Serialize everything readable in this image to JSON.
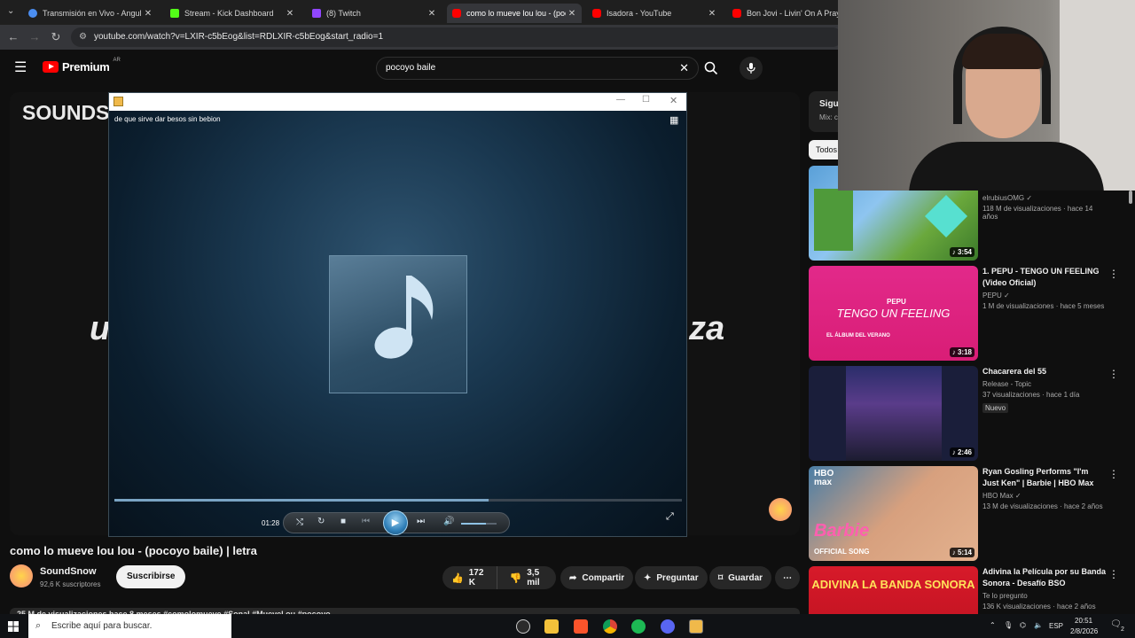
{
  "browser": {
    "tabs": [
      {
        "title": "Transmisión en Vivo - Angulism",
        "color": "#4b8ef1"
      },
      {
        "title": "Stream - Kick Dashboard",
        "color": "#53fc18"
      },
      {
        "title": "(8) Twitch",
        "color": "#9146ff"
      },
      {
        "title": "como lo mueve lou lou - (pocoy",
        "color": "#ff0000"
      },
      {
        "title": "Isadora - YouTube",
        "color": "#ff0000"
      },
      {
        "title": "Bon Jovi - Livin' On A Prayer -",
        "color": "#ff0000"
      }
    ],
    "url": "youtube.com/watch?v=LXIR-c5bEog&list=RDLXIR-c5bEog&start_radio=1"
  },
  "youtube": {
    "brand": "Premium",
    "region": "AR",
    "search_value": "pocoyo baile"
  },
  "video": {
    "bg_text_left": "SOUNDS",
    "bg_text_mid_left": "u",
    "bg_text_mid_right": "za",
    "title": "como lo mueve lou lou - (pocoyo baile) | letra",
    "channel": "SoundSnow",
    "subscribers": "92,6 K suscriptores",
    "subscribe_label": "Suscribirse",
    "likes": "172 K",
    "dislikes": "3,5 mil",
    "share_label": "Compartir",
    "ask_label": "Preguntar",
    "save_label": "Guardar",
    "desc_peek": "25 M de visualizaciones  hace 8 meses  #comolomueve #Sonal #Muevel ou #pocoyo"
  },
  "player": {
    "now_playing": "de que sirve dar besos sin bebion",
    "time": "01:28",
    "progress": 0.66,
    "volume": 0.7
  },
  "sidebar": {
    "partial_header": "Sigui",
    "partial_sub": "Mix: c",
    "chip": "Todos",
    "cards": [
      {
        "title": "",
        "channel": "elrubiusOMG",
        "stats": "118 M de visualizaciones · hace 14 años",
        "duration": "3:54",
        "badge": ""
      },
      {
        "title": "1. PEPU - TENGO UN FEELING (Video Oficial)",
        "channel": "PEPU",
        "stats": "1 M de visualizaciones · hace 5 meses",
        "duration": "3:18",
        "badge": "",
        "thumb_text": "TENGO UN FEELING",
        "thumb_sub": "EL ÁLBUM DEL VERANO",
        "thumb_name": "PEPU"
      },
      {
        "title": "Chacarera del 55",
        "channel": "Release - Topic",
        "stats": "37 visualizaciones · hace 1 día",
        "duration": "2:46",
        "badge": "Nuevo"
      },
      {
        "title": "Ryan Gosling Performs \"I'm Just Ken\" | Barbie | HBO Max",
        "channel": "HBO Max",
        "stats": "13 M de visualizaciones · hace 2 años",
        "duration": "5:14",
        "badge": "",
        "thumb_text": "Barbie",
        "thumb_sub": "OFFICIAL SONG",
        "thumb_logo": "HBO max"
      },
      {
        "title": "Adivina la Película por su Banda Sonora - Desafío BSO",
        "channel": "Te lo pregunto",
        "stats": "136 K visualizaciones · hace 2 años",
        "duration": "",
        "badge": "",
        "thumb_text": "ADIVINA LA BANDA SONORA"
      }
    ]
  },
  "taskbar": {
    "search_placeholder": "Escribe aquí para buscar.",
    "lang": "ESP",
    "time": "20:51",
    "date": "2/8/2026",
    "notif_count": "2"
  }
}
